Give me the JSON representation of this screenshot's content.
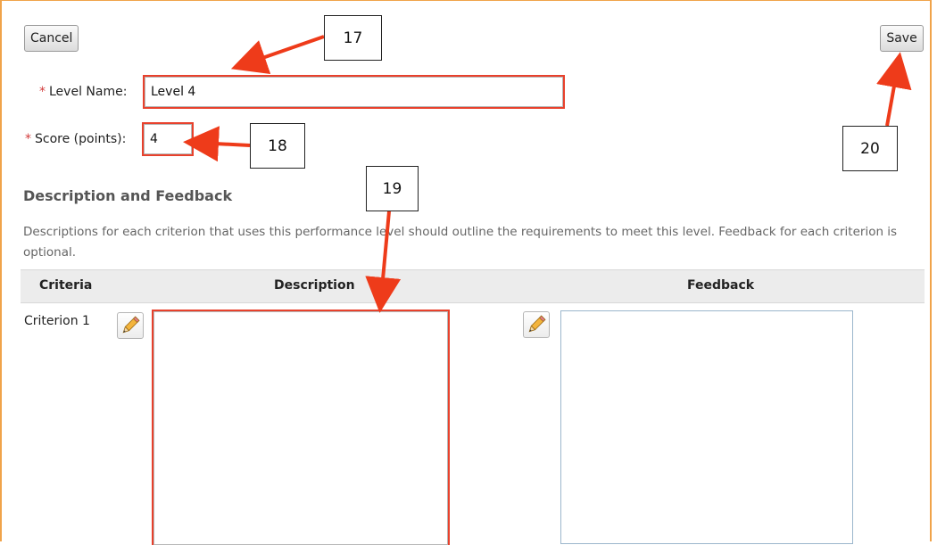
{
  "buttons": {
    "cancel": "Cancel",
    "save": "Save"
  },
  "form": {
    "required_marker": "*",
    "level_name_label": "Level Name:",
    "level_name_value": "Level 4",
    "score_label": "Score (points):",
    "score_value": "4"
  },
  "section": {
    "title": "Description and Feedback",
    "description": "Descriptions for each criterion that uses this performance level should outline the requirements to meet this level. Feedback for each criterion is optional."
  },
  "table": {
    "headers": [
      "Criteria",
      "Description",
      "Feedback"
    ],
    "rows": [
      {
        "criterion": "Criterion 1"
      }
    ]
  },
  "callouts": {
    "c17": "17",
    "c18": "18",
    "c19": "19",
    "c20": "20"
  },
  "colors": {
    "accent_frame": "#f0a34a",
    "highlight": "#e8412c",
    "arrow": "#ee3b1a"
  },
  "icons": {
    "edit": "pencil-icon"
  }
}
